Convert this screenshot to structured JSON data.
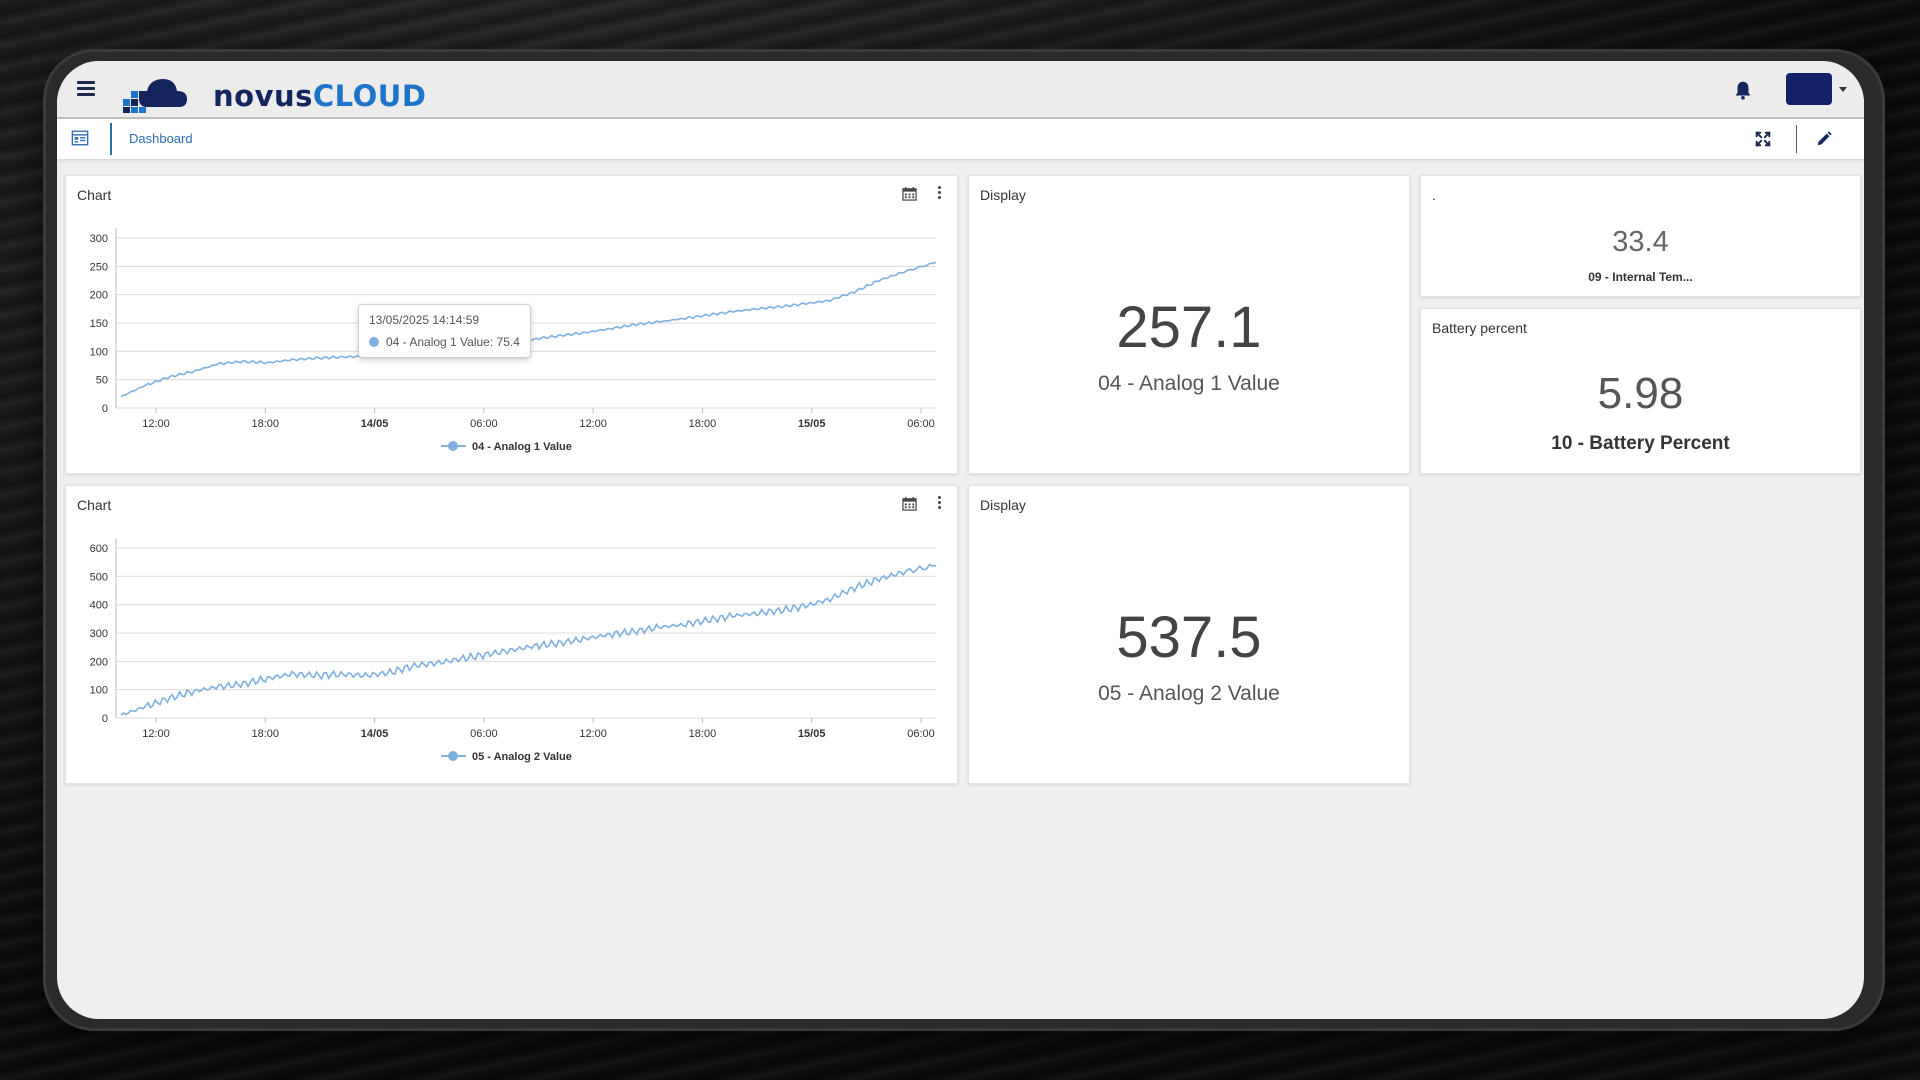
{
  "app": {
    "logo_part1": "novus",
    "logo_part2": "CLOUD"
  },
  "breadcrumb": {
    "label": "Dashboard"
  },
  "widgets": {
    "chart1": {
      "title": "Chart",
      "legend": "04 - Analog 1 Value",
      "tooltip": {
        "time": "13/05/2025 14:14:59",
        "text": "04 - Analog 1 Value: 75.4"
      }
    },
    "chart2": {
      "title": "Chart",
      "legend": "05 - Analog 2 Value"
    },
    "display1": {
      "title": "Display",
      "value": "257.1",
      "label": "04 - Analog 1 Value"
    },
    "display2": {
      "title": "Display",
      "value": "537.5",
      "label": "05 - Analog 2 Value"
    },
    "internal_temp": {
      "title": ".",
      "value": "33.4",
      "label": "09 - Internal Tem..."
    },
    "battery": {
      "title": "Battery percent",
      "value": "5.98",
      "label": "10 - Battery Percent"
    }
  },
  "icons": {
    "menu": "hamburger-icon",
    "bell": "bell-icon",
    "dashboard": "dashboard-icon",
    "expand": "expand-icon",
    "edit": "pencil-icon",
    "calendar": "calendar-icon",
    "more": "more-vertical-icon"
  },
  "colors": {
    "series": "#7fb0e0",
    "brand_dark": "#14245c",
    "brand_light": "#1e74c8",
    "user_box": "#12206a",
    "link": "#2f6db5"
  },
  "chart_data": [
    {
      "type": "line",
      "x_ticks": [
        "12:00",
        "18:00",
        "14/05",
        "06:00",
        "12:00",
        "18:00",
        "15/05",
        "06:00"
      ],
      "x_ticks_bold": [
        false,
        false,
        true,
        false,
        false,
        false,
        true,
        false
      ],
      "y_ticks": [
        0,
        50,
        100,
        150,
        200,
        250,
        300
      ],
      "ylim": [
        0,
        300
      ],
      "legend": "top-bottom",
      "series": [
        {
          "name": "04 - Analog 1 Value",
          "x": [
            0,
            0.03,
            0.06,
            0.09,
            0.12,
            0.15,
            0.18,
            0.21,
            0.24,
            0.27,
            0.3,
            0.33,
            0.36,
            0.39,
            0.42,
            0.45,
            0.48,
            0.51,
            0.54,
            0.57,
            0.6,
            0.63,
            0.66,
            0.69,
            0.72,
            0.75,
            0.78,
            0.81,
            0.84,
            0.87,
            0.9,
            0.93,
            0.96,
            1.0
          ],
          "values": [
            20,
            40,
            55,
            65,
            78,
            82,
            80,
            85,
            88,
            90,
            91,
            91,
            93,
            95,
            100,
            108,
            115,
            122,
            128,
            133,
            140,
            147,
            152,
            158,
            164,
            170,
            175,
            179,
            184,
            190,
            205,
            225,
            240,
            257
          ]
        }
      ]
    },
    {
      "type": "line",
      "x_ticks": [
        "12:00",
        "18:00",
        "14/05",
        "06:00",
        "12:00",
        "18:00",
        "15/05",
        "06:00"
      ],
      "x_ticks_bold": [
        false,
        false,
        true,
        false,
        false,
        false,
        true,
        false
      ],
      "y_ticks": [
        0,
        100,
        200,
        300,
        400,
        500,
        600
      ],
      "ylim": [
        0,
        600
      ],
      "legend": "top-bottom",
      "series": [
        {
          "name": "05 - Analog 2 Value",
          "x": [
            0,
            0.03,
            0.06,
            0.09,
            0.12,
            0.15,
            0.18,
            0.21,
            0.24,
            0.27,
            0.3,
            0.33,
            0.36,
            0.39,
            0.42,
            0.45,
            0.48,
            0.51,
            0.54,
            0.57,
            0.6,
            0.63,
            0.66,
            0.69,
            0.72,
            0.75,
            0.78,
            0.81,
            0.84,
            0.87,
            0.9,
            0.93,
            0.96,
            1.0
          ],
          "values": [
            10,
            40,
            70,
            95,
            110,
            120,
            140,
            155,
            150,
            155,
            150,
            160,
            185,
            195,
            210,
            225,
            240,
            255,
            265,
            280,
            295,
            305,
            320,
            330,
            345,
            360,
            370,
            380,
            395,
            420,
            460,
            490,
            515,
            538
          ]
        }
      ]
    }
  ]
}
